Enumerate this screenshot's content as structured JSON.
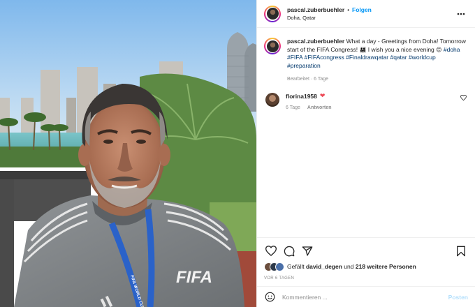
{
  "post": {
    "username": "pascal.zuberbuehler",
    "separator": "•",
    "follow_label": "Folgen",
    "location": "Doha, Qatar"
  },
  "caption": {
    "username": "pascal.zuberbuehler",
    "text_1": " What a day - Greetings from Doha! Tomorrow start of the FIFA Congress! ",
    "emoji_1": "👨‍👩‍👧",
    "text_2": " I wish you a nice evening ",
    "emoji_2": "😊",
    "hashtags": [
      "#doha",
      "#FIFA",
      "#FIFAcongress",
      "#Finaldrawqatar",
      "#qatar",
      "#worldcup",
      "#preparation"
    ],
    "meta": "Bearbeitet · 6 Tage"
  },
  "comment": {
    "username": "florina1958",
    "heart": "❤",
    "time": "6 Tage",
    "reply_label": "Antworten"
  },
  "icons": {
    "more": "more-icon",
    "like": "heart-icon",
    "comment": "comment-icon",
    "share": "share-icon",
    "save": "bookmark-icon",
    "emoji": "emoji-icon"
  },
  "likes": {
    "prefix": "Gefällt",
    "user": "david_degen",
    "connector": "und",
    "others": "218 weitere Personen"
  },
  "date": "VOR 6 TAGEN",
  "composer": {
    "placeholder": "Kommentieren ...",
    "post_label": "Posten"
  },
  "photo": {
    "shirt_logo": "FIFA",
    "lanyard_text": "FIFA WORLD CUP"
  },
  "colors": {
    "accent": "#0095f6",
    "hashtag": "#00376b",
    "heart": "#ed4956",
    "post_disabled": "#b2dffc"
  }
}
